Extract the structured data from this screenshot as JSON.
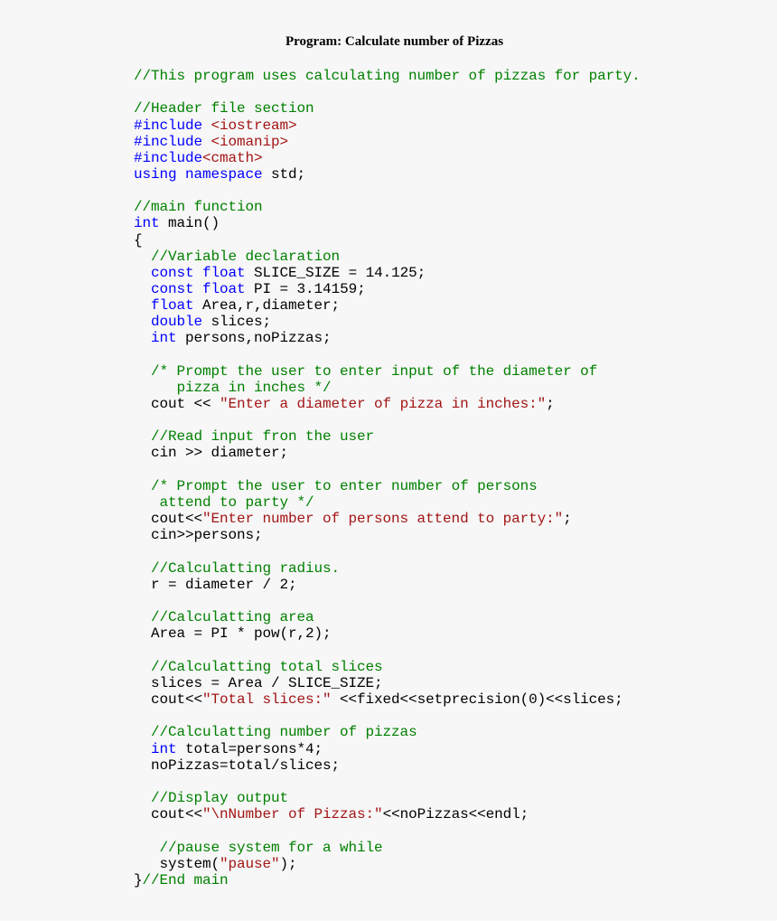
{
  "title": "Program: Calculate number of Pizzas",
  "colors": {
    "background": "#f7f7f7",
    "keyword": "#0000ff",
    "comment": "#008000",
    "string": "#a31515",
    "text": "#000000"
  },
  "lines": [
    [
      {
        "t": "cm",
        "v": "//This program uses calculating number of pizzas for party."
      }
    ],
    [],
    [
      {
        "t": "cm",
        "v": "//Header file section"
      }
    ],
    [
      {
        "t": "kw",
        "v": "#include "
      },
      {
        "t": "st",
        "v": "<iostream>"
      }
    ],
    [
      {
        "t": "kw",
        "v": "#include "
      },
      {
        "t": "st",
        "v": "<iomanip>"
      }
    ],
    [
      {
        "t": "kw",
        "v": "#include"
      },
      {
        "t": "st",
        "v": "<cmath>"
      }
    ],
    [
      {
        "t": "kw",
        "v": "using namespace"
      },
      {
        "t": "tx",
        "v": " std;"
      }
    ],
    [],
    [
      {
        "t": "cm",
        "v": "//main function"
      }
    ],
    [
      {
        "t": "kw",
        "v": "int"
      },
      {
        "t": "tx",
        "v": " main()"
      }
    ],
    [
      {
        "t": "tx",
        "v": "{"
      }
    ],
    [
      {
        "t": "tx",
        "v": "  "
      },
      {
        "t": "cm",
        "v": "//Variable declaration"
      }
    ],
    [
      {
        "t": "tx",
        "v": "  "
      },
      {
        "t": "kw",
        "v": "const float"
      },
      {
        "t": "tx",
        "v": " SLICE_SIZE = 14.125;"
      }
    ],
    [
      {
        "t": "tx",
        "v": "  "
      },
      {
        "t": "kw",
        "v": "const float"
      },
      {
        "t": "tx",
        "v": " PI = 3.14159;"
      }
    ],
    [
      {
        "t": "tx",
        "v": "  "
      },
      {
        "t": "kw",
        "v": "float"
      },
      {
        "t": "tx",
        "v": " Area,r,diameter;"
      }
    ],
    [
      {
        "t": "tx",
        "v": "  "
      },
      {
        "t": "kw",
        "v": "double"
      },
      {
        "t": "tx",
        "v": " slices;"
      }
    ],
    [
      {
        "t": "tx",
        "v": "  "
      },
      {
        "t": "kw",
        "v": "int"
      },
      {
        "t": "tx",
        "v": " persons,noPizzas;"
      }
    ],
    [],
    [
      {
        "t": "tx",
        "v": "  "
      },
      {
        "t": "cm",
        "v": "/* Prompt the user to enter input of the diameter of"
      }
    ],
    [
      {
        "t": "cm",
        "v": "     pizza in inches */"
      }
    ],
    [
      {
        "t": "tx",
        "v": "  cout << "
      },
      {
        "t": "st",
        "v": "\"Enter a diameter of pizza in inches:\""
      },
      {
        "t": "tx",
        "v": ";"
      }
    ],
    [],
    [
      {
        "t": "tx",
        "v": "  "
      },
      {
        "t": "cm",
        "v": "//Read input fron the user"
      }
    ],
    [
      {
        "t": "tx",
        "v": "  cin >> diameter;"
      }
    ],
    [],
    [
      {
        "t": "tx",
        "v": "  "
      },
      {
        "t": "cm",
        "v": "/* Prompt the user to enter number of persons"
      }
    ],
    [
      {
        "t": "cm",
        "v": "   attend to party */"
      }
    ],
    [
      {
        "t": "tx",
        "v": "  cout<<"
      },
      {
        "t": "st",
        "v": "\"Enter number of persons attend to party:\""
      },
      {
        "t": "tx",
        "v": ";"
      }
    ],
    [
      {
        "t": "tx",
        "v": "  cin>>persons;"
      }
    ],
    [],
    [
      {
        "t": "tx",
        "v": "  "
      },
      {
        "t": "cm",
        "v": "//Calculatting radius."
      }
    ],
    [
      {
        "t": "tx",
        "v": "  r = diameter / 2;"
      }
    ],
    [],
    [
      {
        "t": "tx",
        "v": "  "
      },
      {
        "t": "cm",
        "v": "//Calculatting area"
      }
    ],
    [
      {
        "t": "tx",
        "v": "  Area = PI * pow(r,2);"
      }
    ],
    [],
    [
      {
        "t": "tx",
        "v": "  "
      },
      {
        "t": "cm",
        "v": "//Calculatting total slices"
      }
    ],
    [
      {
        "t": "tx",
        "v": "  slices = Area / SLICE_SIZE;"
      }
    ],
    [
      {
        "t": "tx",
        "v": "  cout<<"
      },
      {
        "t": "st",
        "v": "\"Total slices:\""
      },
      {
        "t": "tx",
        "v": " <<fixed<<setprecision(0)<<slices;"
      }
    ],
    [],
    [
      {
        "t": "tx",
        "v": "  "
      },
      {
        "t": "cm",
        "v": "//Calculatting number of pizzas"
      }
    ],
    [
      {
        "t": "tx",
        "v": "  "
      },
      {
        "t": "kw",
        "v": "int"
      },
      {
        "t": "tx",
        "v": " total=persons*4;"
      }
    ],
    [
      {
        "t": "tx",
        "v": "  noPizzas=total/slices;"
      }
    ],
    [],
    [
      {
        "t": "tx",
        "v": "  "
      },
      {
        "t": "cm",
        "v": "//Display output"
      }
    ],
    [
      {
        "t": "tx",
        "v": "  cout<<"
      },
      {
        "t": "st",
        "v": "\"\\nNumber of Pizzas:\""
      },
      {
        "t": "tx",
        "v": "<<noPizzas<<endl;"
      }
    ],
    [],
    [
      {
        "t": "tx",
        "v": "   "
      },
      {
        "t": "cm",
        "v": "//pause system for a while"
      }
    ],
    [
      {
        "t": "tx",
        "v": "   system("
      },
      {
        "t": "st",
        "v": "\"pause\""
      },
      {
        "t": "tx",
        "v": ");"
      }
    ],
    [
      {
        "t": "tx",
        "v": "}"
      },
      {
        "t": "cm",
        "v": "//End main"
      }
    ]
  ]
}
